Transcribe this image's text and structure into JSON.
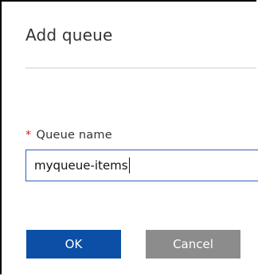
{
  "dialog": {
    "title": "Add queue"
  },
  "form": {
    "required_marker": "*",
    "queue_name_label": "Queue name",
    "queue_name_value": "myqueue-items"
  },
  "actions": {
    "ok_label": "OK",
    "cancel_label": "Cancel"
  },
  "colors": {
    "primary_button": "#0b4fa6",
    "secondary_button": "#8c8c8c",
    "required_star": "#d9201f",
    "input_focus_border": "#2a5fbf"
  }
}
